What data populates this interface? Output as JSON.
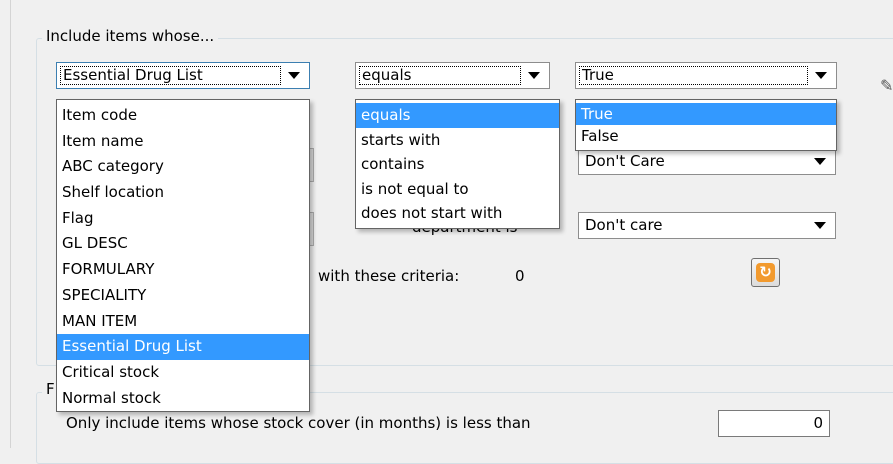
{
  "group_include": {
    "legend": "Include items whose..."
  },
  "field_combo": {
    "value": "Essential Drug List"
  },
  "field_options": [
    "Item code",
    "Item name",
    "ABC category",
    "Shelf location",
    "Flag",
    "GL DESC",
    "FORMULARY",
    "SPECIALITY",
    "MAN ITEM",
    "Essential Drug List",
    "Critical stock",
    "Normal stock"
  ],
  "field_selected_index": 9,
  "operator_combo": {
    "value": "equals"
  },
  "operator_options": [
    "equals",
    "starts with",
    "contains",
    "is not equal to",
    "does not start with"
  ],
  "operator_selected_index": 0,
  "value_combo": {
    "value": "True"
  },
  "value_options": [
    "True",
    "False"
  ],
  "value_selected_index": 0,
  "combo_dont_care_1": {
    "value": "Don't Care"
  },
  "combo_dont_care_2": {
    "value": "Don't care"
  },
  "department_label": "department is",
  "criteria_count": {
    "label": "with these criteria:",
    "value": "0"
  },
  "refresh_button": {
    "icon": "refresh-icon"
  },
  "group_filter": {
    "legend": "F"
  },
  "stock_cover": {
    "label": "Only include items whose stock cover (in months) is less than",
    "value": "0"
  },
  "colors": {
    "highlight": "#3399ff",
    "refresh_icon": "#f29a2e"
  }
}
